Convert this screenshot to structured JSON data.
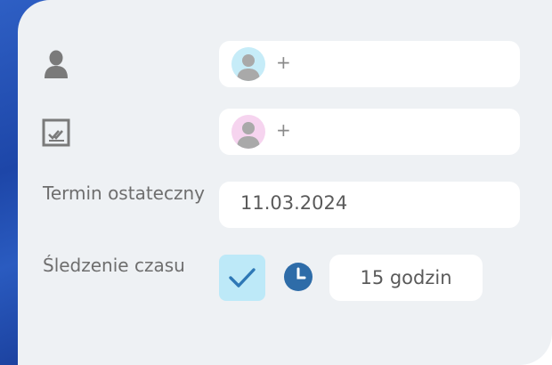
{
  "assignee": {
    "icon": "person-icon",
    "avatar_icon": "user-avatar-icon",
    "avatar_bg": "#c6ecf8",
    "add_label": "+"
  },
  "reviewer": {
    "icon": "checklist-icon",
    "avatar_icon": "user-avatar-icon",
    "avatar_bg": "#f6d4ef",
    "add_label": "+"
  },
  "deadline": {
    "label": "Termin ostateczny",
    "value": "11.03.2024"
  },
  "time_tracking": {
    "label": "Śledzenie czasu",
    "checked": true,
    "check_bg": "#bde9f8",
    "check_color": "#2e78b6",
    "clock_icon": "clock-icon",
    "clock_color": "#2e6ca8",
    "hours_value": "15 godzin"
  },
  "colors": {
    "panel_bg": "#eef1f4",
    "accent_blue": "#1d46a8",
    "label_text": "#6e6e6e",
    "icon_gray": "#7a7a7a"
  }
}
